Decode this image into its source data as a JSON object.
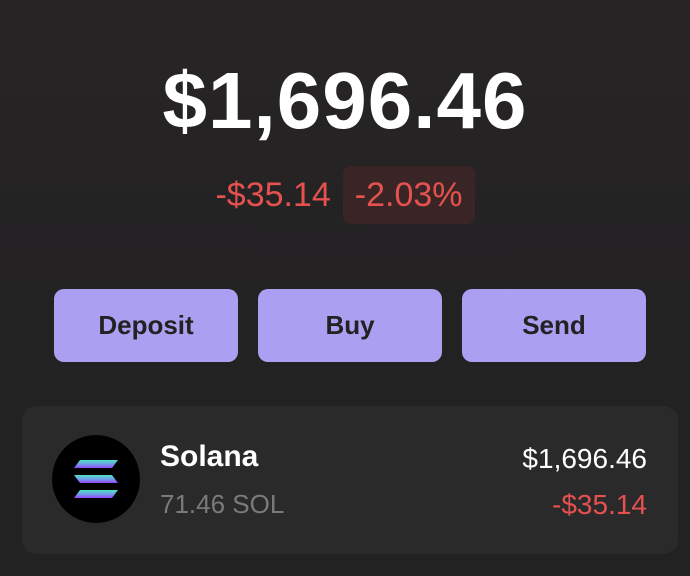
{
  "portfolio": {
    "balance": "$1,696.46",
    "change_amount": "-$35.14",
    "change_percent": "-2.03%"
  },
  "actions": {
    "deposit_label": "Deposit",
    "buy_label": "Buy",
    "send_label": "Send"
  },
  "tokens": [
    {
      "name": "Solana",
      "quantity": "71.46 SOL",
      "value": "$1,696.46",
      "change": "-$35.14",
      "icon": "solana-logo-icon"
    }
  ],
  "colors": {
    "accent": "#ab9ff2",
    "negative": "#e4514f",
    "background": "#242223",
    "card": "#2a2a2a"
  }
}
